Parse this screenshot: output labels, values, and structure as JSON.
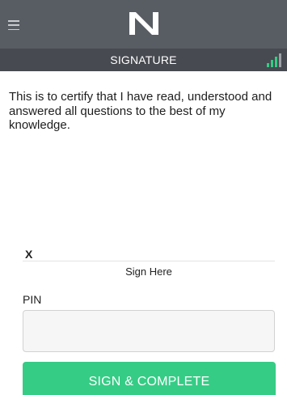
{
  "header": {
    "menu_icon": "hamburger-menu-icon",
    "logo_icon": "n-logo-icon",
    "signal_icon": "signal-strength-icon",
    "signal_color": "#35cc85"
  },
  "subheader": {
    "title": "SIGNATURE"
  },
  "certification": {
    "text": "This is to certify that I have read, understood and answered all questions to the best of my knowledge."
  },
  "signature": {
    "marker": "X",
    "caption": "Sign Here"
  },
  "pin": {
    "label": "PIN",
    "value": "",
    "placeholder": ""
  },
  "actions": {
    "submit_label": "SIGN & COMPLETE",
    "submit_color": "#35cc85"
  }
}
